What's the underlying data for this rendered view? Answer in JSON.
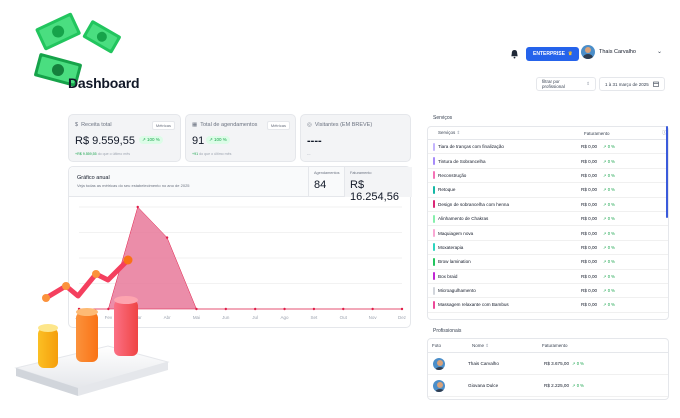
{
  "header": {
    "title": "Dashboard",
    "enterprise_label": "ENTERPRISE",
    "user_name": "Thais Carvalho",
    "filter_professional": "filtrar por profissional",
    "date_range": "1 à 31 março de 2025"
  },
  "cards": {
    "revenue": {
      "label": "Receita total",
      "tag": "Métricas",
      "value": "R$ 9.559,55",
      "change": "100 %",
      "sub_prefix": "+R$ 9.559,55",
      "sub_suffix": "do que o último mês"
    },
    "appointments": {
      "label": "Total de agendamentos",
      "tag": "Métricas",
      "value": "91",
      "change": "100 %",
      "sub_prefix": "+91",
      "sub_suffix": "do que o último mês"
    },
    "visitors": {
      "label": "Visitantes (EM BREVE)",
      "value": "----",
      "sub": "---"
    }
  },
  "chart_panel": {
    "title": "Gráfico anual",
    "subtitle": "Veja todas as métricas do seu estabelecimento no ano de 2025",
    "kpi_appointments_label": "Agendamentos",
    "kpi_appointments_value": "84",
    "kpi_revenue_label": "Faturamento",
    "kpi_revenue_value": "R$ 16.254,56"
  },
  "chart_data": {
    "type": "area",
    "categories": [
      "Jan",
      "Fev",
      "Mar",
      "Abr",
      "Mai",
      "Jun",
      "Jul",
      "Ago",
      "Set",
      "Out",
      "Nov",
      "Dez"
    ],
    "series": [
      {
        "values": [
          0,
          0,
          100,
          70,
          0,
          0,
          0,
          0,
          0,
          0,
          0,
          0
        ]
      }
    ],
    "ylim": [
      0,
      100
    ],
    "grid": true,
    "color": "#e8799a"
  },
  "services": {
    "title": "Serviços",
    "col_service": "Serviços",
    "col_revenue": "Faturamento",
    "rows": [
      {
        "name": "Tiara de tranças com finalização",
        "price": "R$ 0,00",
        "pct": "0 %",
        "color": "#c4b5fd"
      },
      {
        "name": "Tintura de Sobrancelha",
        "price": "R$ 0,00",
        "pct": "0 %",
        "color": "#a78bfa"
      },
      {
        "name": "Reconstrução",
        "price": "R$ 0,00",
        "pct": "0 %",
        "color": "#f472b6"
      },
      {
        "name": "Retoque",
        "price": "R$ 0,00",
        "pct": "0 %",
        "color": "#14b8a6"
      },
      {
        "name": "Design de sobrancelha com henna",
        "price": "R$ 0,00",
        "pct": "0 %",
        "color": "#db2777"
      },
      {
        "name": "Alinhamento de Chakras",
        "price": "R$ 0,00",
        "pct": "0 %",
        "color": "#86efac"
      },
      {
        "name": "Maquiagem nova",
        "price": "R$ 0,00",
        "pct": "0 %",
        "color": "#f9a8d4"
      },
      {
        "name": "Moxaterapia",
        "price": "R$ 0,00",
        "pct": "0 %",
        "color": "#2dd4bf"
      },
      {
        "name": "Brow lamination",
        "price": "R$ 0,00",
        "pct": "0 %",
        "color": "#22c55e"
      },
      {
        "name": "Box braid",
        "price": "R$ 0,00",
        "pct": "0 %",
        "color": "#c026d3"
      },
      {
        "name": "Microagulhamento",
        "price": "R$ 0,00",
        "pct": "0 %",
        "color": "#d1d5db"
      },
      {
        "name": "Massagem relaxante com Bambus",
        "price": "R$ 0,00",
        "pct": "0 %",
        "color": "#ec4899"
      }
    ]
  },
  "professionals": {
    "title": "Profissionais",
    "col_photo": "Foto",
    "col_name": "Nome",
    "col_revenue": "Faturamento",
    "rows": [
      {
        "name": "Thais Carvalho",
        "value": "R$ 3.675,00",
        "pct": "0 %"
      },
      {
        "name": "Giovana Dulce",
        "value": "R$ 2.225,00",
        "pct": "0 %"
      }
    ]
  }
}
